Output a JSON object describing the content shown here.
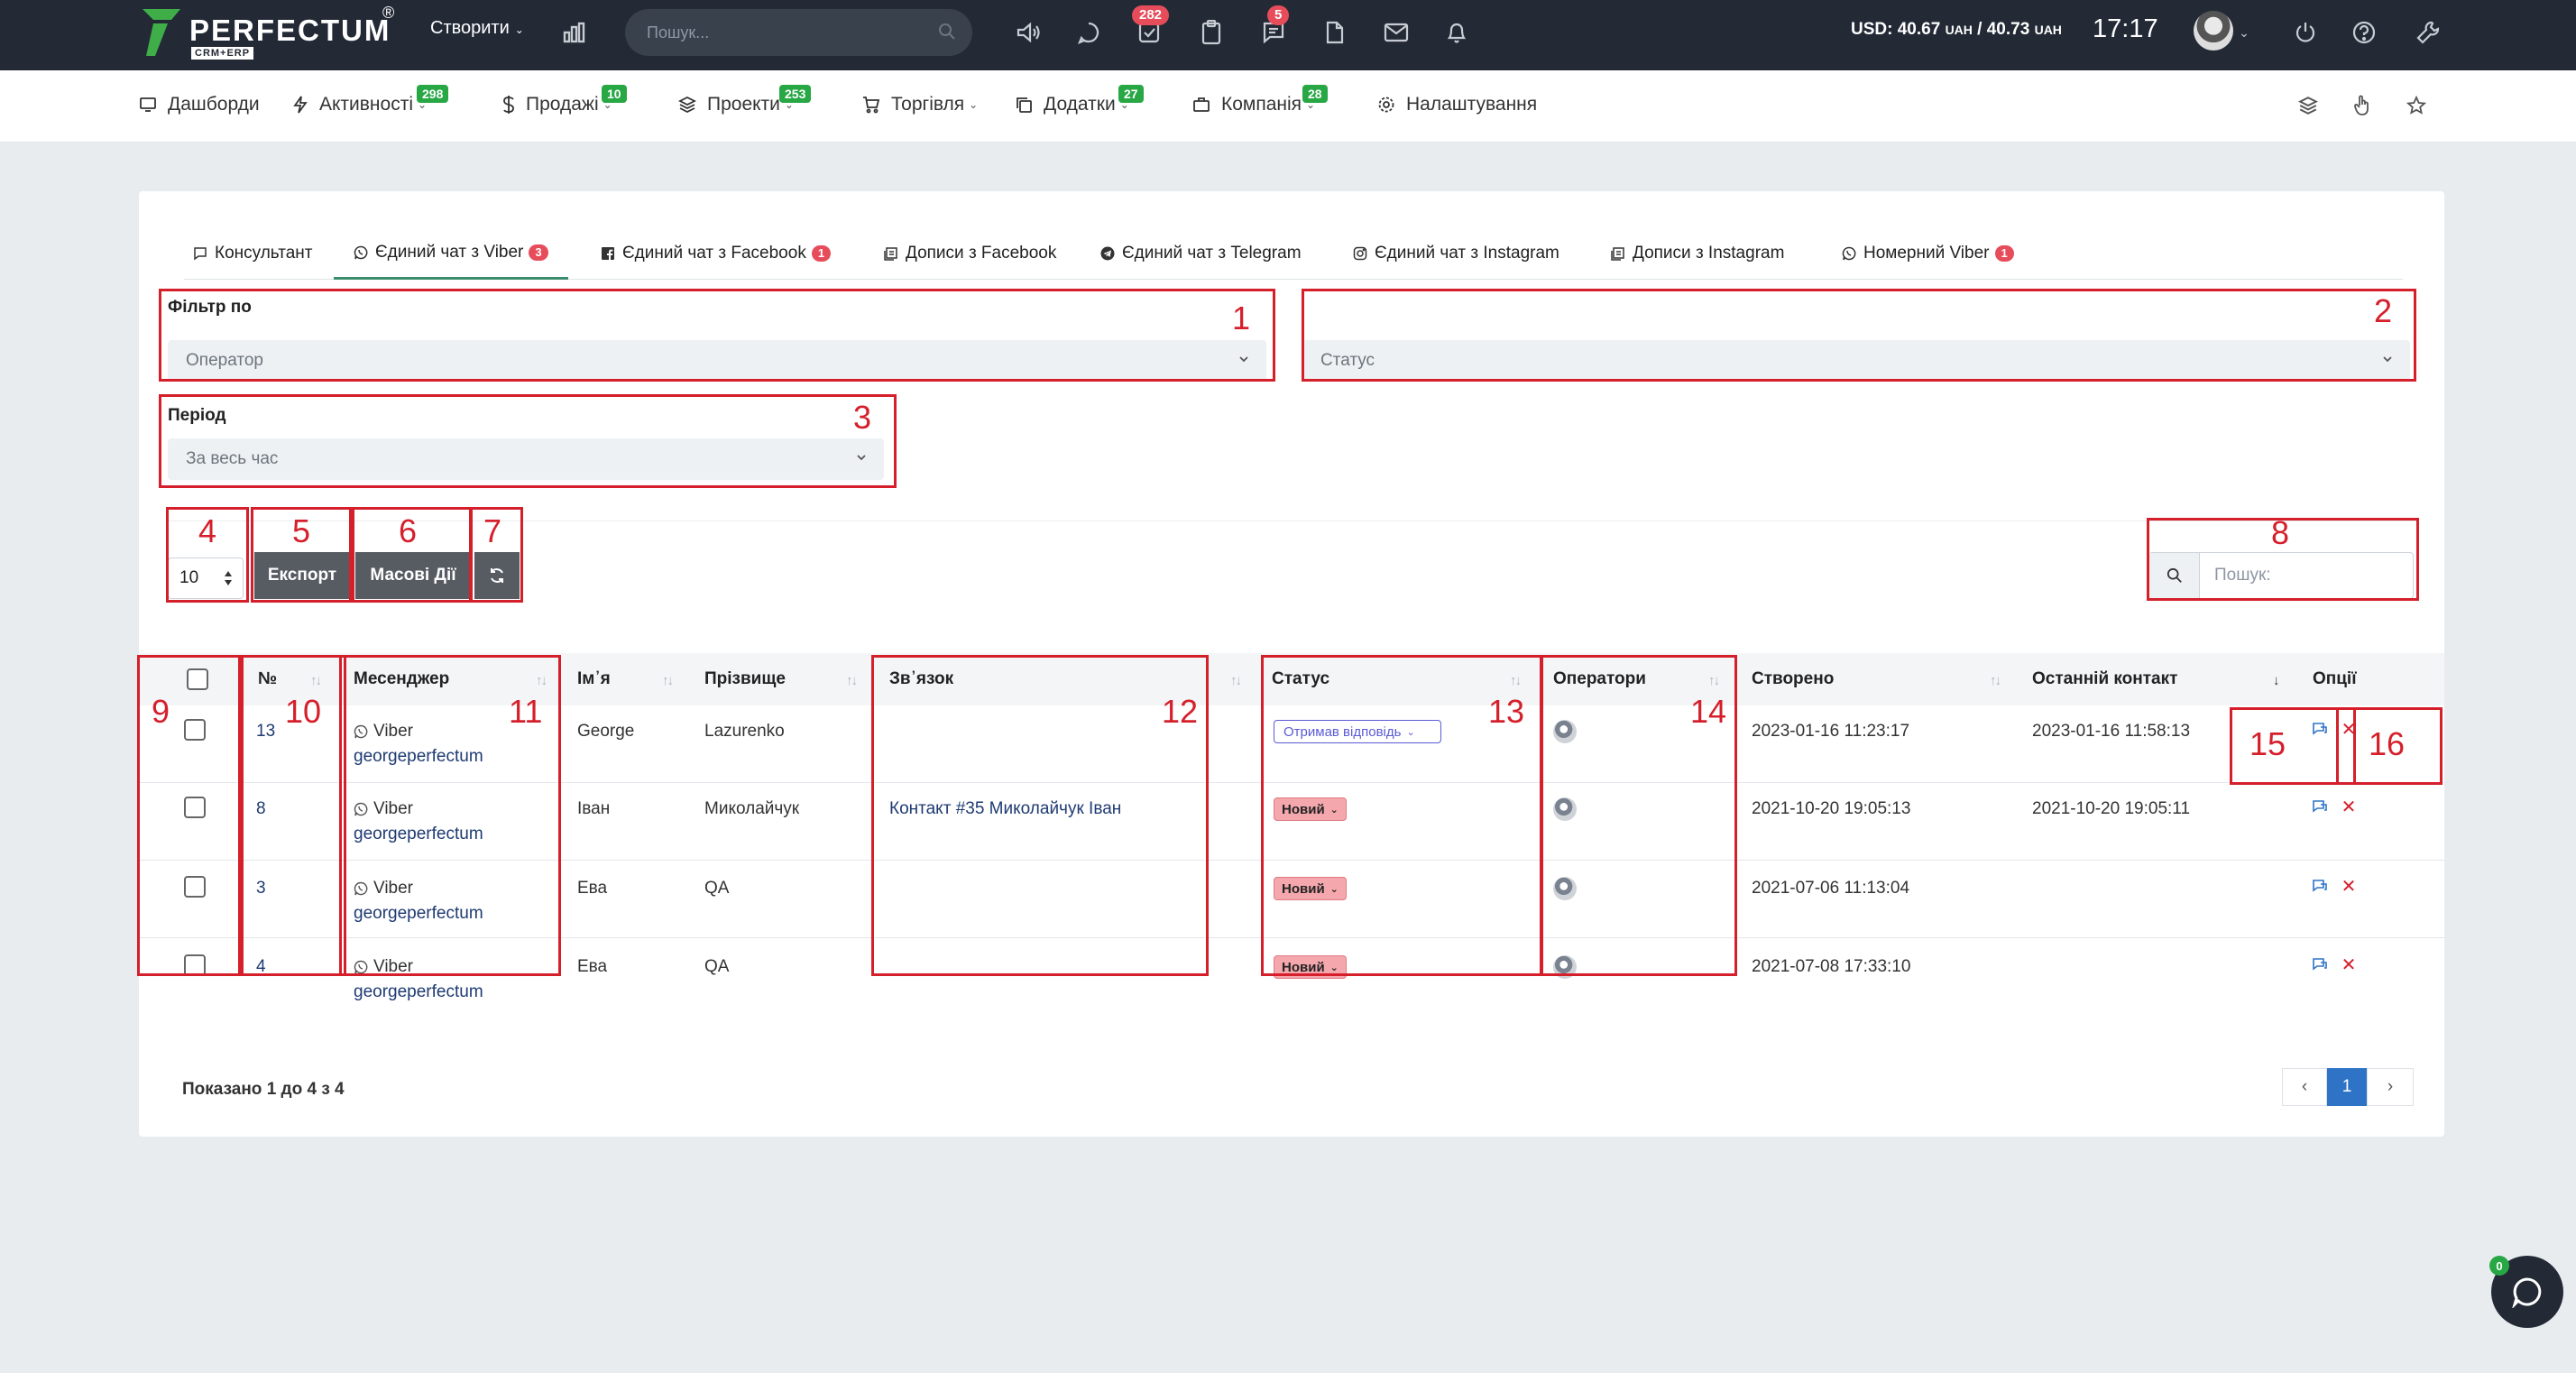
{
  "app": {
    "logo_text": "PERFECTUM",
    "logo_reg": "®",
    "logo_sub": "CRM+ERP"
  },
  "topbar": {
    "create_label": "Створити",
    "search_placeholder": "Пошук...",
    "tasks_badge": "282",
    "messages_badge": "5",
    "currency_usd": "USD: 40.67",
    "currency_unit1": "UAH",
    "currency_sep": " / 40.73",
    "currency_unit2": "UAH",
    "time": "17:17"
  },
  "nav": {
    "items": [
      {
        "label": "Дашборди",
        "icon": "monitor-icon",
        "badge": ""
      },
      {
        "label": "Активності",
        "icon": "bolt-icon",
        "badge": "298"
      },
      {
        "label": "Продажі",
        "icon": "dollar-icon",
        "badge": "10"
      },
      {
        "label": "Проекти",
        "icon": "layers-icon",
        "badge": "253"
      },
      {
        "label": "Торгівля",
        "icon": "cart-icon",
        "badge": ""
      },
      {
        "label": "Додатки",
        "icon": "copy-icon",
        "badge": "27"
      },
      {
        "label": "Компанія",
        "icon": "briefcase-icon",
        "badge": "28"
      },
      {
        "label": "Налаштування",
        "icon": "gear-icon",
        "badge": ""
      }
    ]
  },
  "tabs": [
    {
      "label": "Консультант",
      "count": ""
    },
    {
      "label": "Єдиний чат з Viber",
      "count": "3"
    },
    {
      "label": "Єдиний чат з Facebook",
      "count": "1"
    },
    {
      "label": "Дописи з Facebook",
      "count": ""
    },
    {
      "label": "Єдиний чат з Telegram",
      "count": ""
    },
    {
      "label": "Єдиний чат з Instagram",
      "count": ""
    },
    {
      "label": "Дописи з Instagram",
      "count": ""
    },
    {
      "label": "Номерний Viber",
      "count": "1"
    }
  ],
  "filters": {
    "filter_by_label": "Фільтр по",
    "operator_placeholder": "Оператор",
    "status_placeholder": "Статус",
    "period_label": "Період",
    "period_value": "За весь час"
  },
  "controls": {
    "page_length": "10",
    "export_label": "Експорт",
    "bulk_label": "Масові Дії",
    "search_placeholder": "Пошук:"
  },
  "table": {
    "headers": {
      "num": "№",
      "messenger": "Месенджер",
      "first_name": "Ім᾽я",
      "last_name": "Прізвище",
      "link": "Зв᾽язок",
      "status": "Статус",
      "operators": "Оператори",
      "created": "Створено",
      "last_contact": "Останній контакт",
      "options": "Опції"
    },
    "rows": [
      {
        "num": "13",
        "messenger": "Viber",
        "account": "georgeperfectum",
        "first_name": "George",
        "last_name": "Lazurenko",
        "link": "",
        "status": "Отримав відповідь",
        "created": "2023-01-16 11:23:17",
        "last_contact": "2023-01-16 11:58:13"
      },
      {
        "num": "8",
        "messenger": "Viber",
        "account": "georgeperfectum",
        "first_name": "Іван",
        "last_name": "Миколайчук",
        "link": "Контакт #35 Миколайчук Іван",
        "status": "Новий",
        "created": "2021-10-20 19:05:13",
        "last_contact": "2021-10-20 19:05:11"
      },
      {
        "num": "3",
        "messenger": "Viber",
        "account": "georgeperfectum",
        "first_name": "Ева",
        "last_name": "QA",
        "link": "",
        "status": "Новий",
        "created": "2021-07-06 11:13:04",
        "last_contact": ""
      },
      {
        "num": "4",
        "messenger": "Viber",
        "account": "georgeperfectum",
        "first_name": "Ева",
        "last_name": "QA",
        "link": "",
        "status": "Новий",
        "created": "2021-07-08 17:33:10",
        "last_contact": ""
      }
    ]
  },
  "footer": {
    "summary": "Показано 1 до 4 з 4",
    "current_page": "1"
  },
  "chat_widget": {
    "badge": "0"
  },
  "annotations": [
    "1",
    "2",
    "3",
    "4",
    "5",
    "6",
    "7",
    "8",
    "9",
    "10",
    "11",
    "12",
    "13",
    "14",
    "15",
    "16"
  ],
  "colors": {
    "topbar_bg": "#232a36",
    "accent_green": "#28a745",
    "badge_red": "#e74c5b",
    "annotation_red": "#d51f2b",
    "button_gray": "#575c63",
    "link_blue": "#1e3a72",
    "page_active": "#2f73c7"
  }
}
